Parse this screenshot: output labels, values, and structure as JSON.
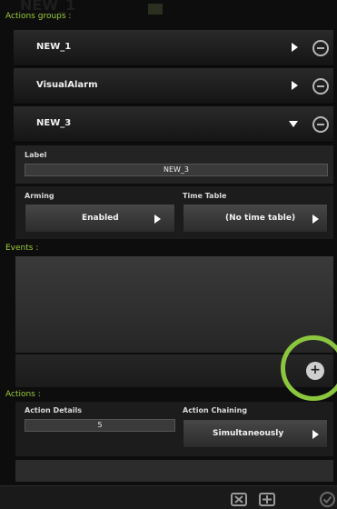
{
  "header": {
    "section_label": "Actions groups :",
    "watermark": "NEW_1"
  },
  "groups": [
    {
      "name": "NEW_1",
      "state": "collapsed"
    },
    {
      "name": "VisualAlarm",
      "state": "collapsed"
    },
    {
      "name": "NEW_3",
      "state": "expanded"
    }
  ],
  "detail": {
    "label_title": "Label",
    "label_value": "NEW_3",
    "arming_title": "Arming",
    "arming_value": "Enabled",
    "timetable_title": "Time Table",
    "timetable_value": "(No time table)"
  },
  "events": {
    "section_label": "Events :",
    "add_symbol": "+"
  },
  "actions": {
    "section_label": "Actions :",
    "details_title": "Action Details",
    "details_value": "5",
    "chaining_title": "Action Chaining",
    "chaining_value": "Simultaneously"
  },
  "colors": {
    "accent_green": "#9acd32",
    "highlight_ring": "#8cc63f",
    "background": "#0d0d0d"
  },
  "icons": {
    "collapse_row": "triangle-right-icon",
    "expand_row": "triangle-down-icon",
    "remove_group": "minus-circle-icon",
    "cancel": "x-box-icon",
    "add": "plus-box-icon",
    "confirm": "check-circle-icon"
  }
}
